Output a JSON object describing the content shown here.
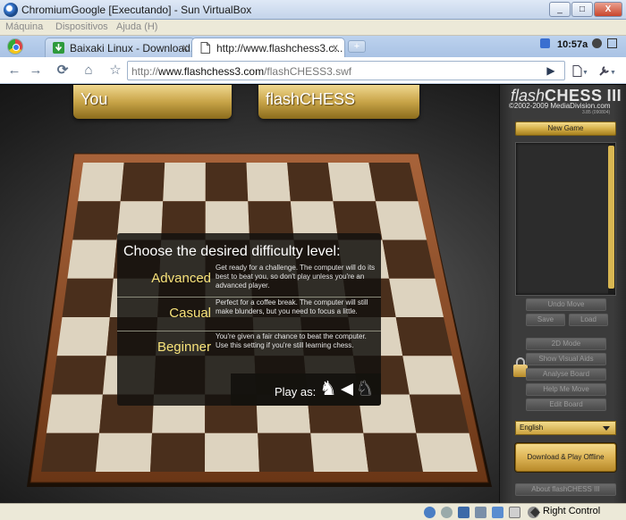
{
  "window": {
    "title": "ChromiumGoogle [Executando] - Sun VirtualBox",
    "min": "_",
    "max": "□",
    "close": "X"
  },
  "vb_menu": [
    "Máquina",
    "Dispositivos",
    "Ajuda (H)"
  ],
  "tabs": [
    {
      "label": "Baixaki Linux - Download...",
      "close": "x",
      "icon": "baixaki-icon"
    },
    {
      "label": "http://www.flashchess3.c...",
      "close": "x",
      "icon": "page-icon"
    }
  ],
  "new_tab": "+",
  "clock": "10:57a",
  "toolbar": {
    "back": "←",
    "forward": "→",
    "reload": "⟳",
    "home": "⌂",
    "star": "☆",
    "url_prefix": "http://",
    "url_domain": "www.flashchess3.com",
    "url_path": "/flashCHESS3.swf",
    "go": "▶",
    "page_menu": "▼",
    "wrench_menu": "▼"
  },
  "game": {
    "player_left": "You",
    "player_right": "flashCHESS",
    "dialog": {
      "heading": "Choose the desired difficulty level:",
      "levels": [
        {
          "name": "Advanced",
          "desc": "Get ready for a challenge. The computer will do its best to beat you, so don't play unless you're an advanced player."
        },
        {
          "name": "Casual",
          "desc": "Perfect for a coffee break. The computer will still make blunders, but you need to focus a little."
        },
        {
          "name": "Beginner",
          "desc": "You're given a fair chance to beat the computer. Use this setting if you're still learning chess."
        }
      ],
      "play_as": "Play as:",
      "white_knight": "♞",
      "black_knight": "♞"
    }
  },
  "panel": {
    "logo_a": "flash",
    "logo_b": "CHESS",
    "logo_c": "III",
    "copyright": "©2002-2009 MediaDivision.com",
    "version": "3.85 (090804)",
    "new_game": "New Game",
    "undo": "Undo Move",
    "save": "Save",
    "load": "Load",
    "mode_2d": "2D Mode",
    "visual_aids": "Show Visual Aids",
    "analyse": "Analyse Board",
    "help_move": "Help Me Move",
    "edit_board": "Edit Board",
    "language": "English",
    "download": "Download & Play Offline",
    "about": "About flashCHESS III"
  },
  "statusbar": {
    "right_control": "Right Control"
  },
  "colors": {
    "light_square": "#ddd3bf",
    "dark_square": "#4a2f1c",
    "frame": "#8a4a22",
    "gold": "#d6b04a",
    "level_name": "#f7e27a"
  }
}
